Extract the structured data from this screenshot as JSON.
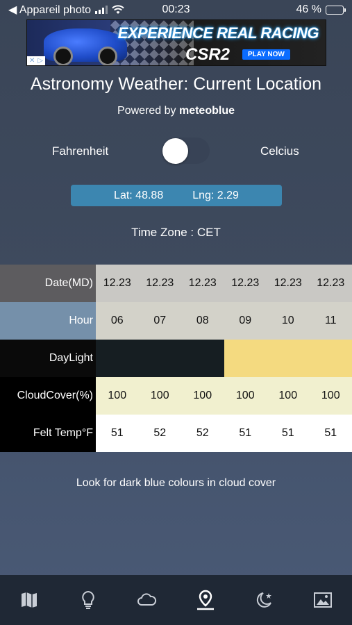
{
  "status_bar": {
    "back_label": "◀ Appareil photo",
    "time": "00:23",
    "battery_text": "46 %",
    "battery_level": 0.46
  },
  "ad": {
    "headline": "EXPERIENCE REAL RACING",
    "brand": "CSR2",
    "cta": "PLAY NOW"
  },
  "header": {
    "title": "Astronomy Weather: Current Location",
    "powered_prefix": "Powered by",
    "powered_brand": "meteoblue"
  },
  "units": {
    "left_label": "Fahrenheit",
    "right_label": "Celcius",
    "selected": "Fahrenheit"
  },
  "location": {
    "lat_text": "Lat: 48.88",
    "lng_text": "Lng: 2.29"
  },
  "timezone_text": "Time Zone : CET",
  "forecast": {
    "rows": [
      {
        "label": "Date(MD)",
        "values": [
          "12.23",
          "12.23",
          "12.23",
          "12.23",
          "12.23",
          "12.23"
        ]
      },
      {
        "label": "Hour",
        "values": [
          "06",
          "07",
          "08",
          "09",
          "10",
          "11"
        ]
      },
      {
        "label": "DayLight",
        "values": [
          "",
          "",
          "",
          "",
          "",
          ""
        ]
      },
      {
        "label": "CloudCover(%)",
        "values": [
          "100",
          "100",
          "100",
          "100",
          "100",
          "100"
        ]
      },
      {
        "label": "Felt Temp°F",
        "values": [
          "51",
          "52",
          "52",
          "51",
          "51",
          "51"
        ]
      }
    ],
    "daylight_colors": [
      "#161e22",
      "#161e22",
      "#161e22",
      "#f4da80",
      "#f4da80",
      "#f4da80"
    ]
  },
  "hint": "Look for dark blue colours in cloud cover",
  "tabbar": {
    "items": [
      {
        "icon": "map-icon"
      },
      {
        "icon": "lightbulb-icon"
      },
      {
        "icon": "cloud-icon"
      },
      {
        "icon": "location-pin-icon",
        "active": true
      },
      {
        "icon": "moon-star-icon"
      },
      {
        "icon": "image-icon"
      }
    ]
  }
}
